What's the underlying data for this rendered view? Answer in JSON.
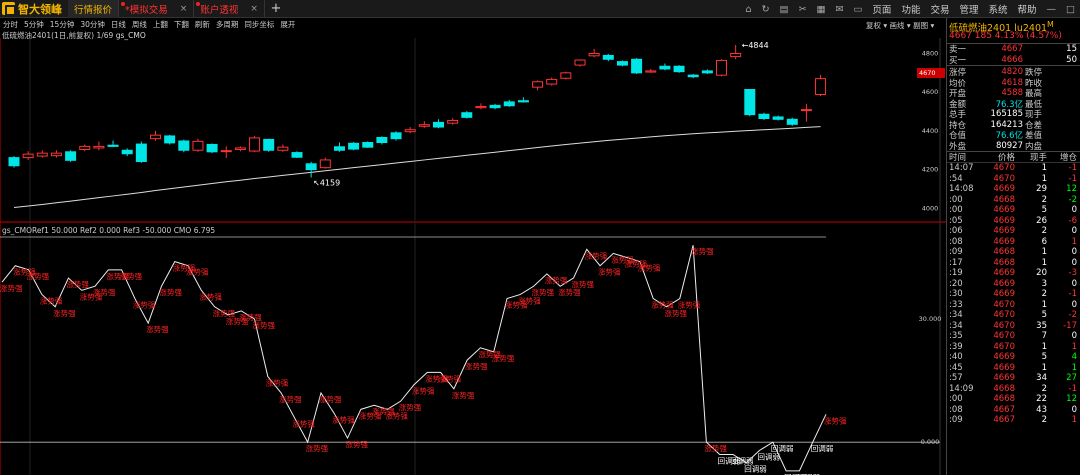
{
  "app": {
    "logo": "智大领峰",
    "tabs": [
      {
        "label": "行情报价",
        "active": true
      },
      {
        "label": "*模拟交易",
        "active": false
      },
      {
        "label": "账户透视",
        "active": false
      }
    ],
    "tab_close": "×",
    "new_tab": "+",
    "menu": [
      "页面",
      "功能",
      "交易",
      "管理",
      "系统",
      "帮助"
    ]
  },
  "toolbar": {
    "items": [
      "分时",
      "5分钟",
      "15分钟",
      "30分钟",
      "日线",
      "周线",
      "上翻",
      "下翻",
      "刷新",
      "多周期",
      "同步坐标",
      "展开"
    ],
    "right": [
      "复权",
      "画线",
      "副图"
    ]
  },
  "chart_title": {
    "text": "低硫燃油2401(1日,前复权) 1/69",
    "indicator": "gs_CMO"
  },
  "indicator_title": "gs_CMORef1 50.000 Ref2 0.000 Ref3 -50.000 CMO 6.795",
  "main_chart": {
    "y_ticks": [
      "4800",
      "4600",
      "4400",
      "4200",
      "4000"
    ],
    "high_label": "4844",
    "low_label": "4159",
    "current_price_tag": "4670"
  },
  "indicator_chart": {
    "y_ticks": [
      "30.000",
      "0.000"
    ],
    "strong_label": "涨势强",
    "weak_label": "回调弱"
  },
  "chart_data": [
    {
      "type": "candlestick",
      "title": "低硫燃油2401(1日,前复权)",
      "ylim": [
        3950,
        4880
      ],
      "candles": [
        {
          "o": 4262,
          "c": 4220,
          "h": 4270,
          "l": 4210
        },
        {
          "o": 4262,
          "c": 4280,
          "h": 4295,
          "l": 4250
        },
        {
          "o": 4270,
          "c": 4285,
          "h": 4300,
          "l": 4262
        },
        {
          "o": 4272,
          "c": 4285,
          "h": 4300,
          "l": 4262
        },
        {
          "o": 4292,
          "c": 4248,
          "h": 4300,
          "l": 4240
        },
        {
          "o": 4304,
          "c": 4320,
          "h": 4330,
          "l": 4295
        },
        {
          "o": 4312,
          "c": 4320,
          "h": 4345,
          "l": 4300
        },
        {
          "o": 4326,
          "c": 4320,
          "h": 4350,
          "l": 4316
        },
        {
          "o": 4300,
          "c": 4282,
          "h": 4310,
          "l": 4270
        },
        {
          "o": 4332,
          "c": 4242,
          "h": 4345,
          "l": 4235
        },
        {
          "o": 4360,
          "c": 4378,
          "h": 4400,
          "l": 4350
        },
        {
          "o": 4374,
          "c": 4338,
          "h": 4380,
          "l": 4330
        },
        {
          "o": 4348,
          "c": 4300,
          "h": 4355,
          "l": 4290
        },
        {
          "o": 4300,
          "c": 4346,
          "h": 4360,
          "l": 4292
        },
        {
          "o": 4330,
          "c": 4292,
          "h": 4335,
          "l": 4285
        },
        {
          "o": 4294,
          "c": 4298,
          "h": 4320,
          "l": 4260
        },
        {
          "o": 4304,
          "c": 4312,
          "h": 4320,
          "l": 4295
        },
        {
          "o": 4296,
          "c": 4364,
          "h": 4375,
          "l": 4290
        },
        {
          "o": 4356,
          "c": 4300,
          "h": 4360,
          "l": 4292
        },
        {
          "o": 4300,
          "c": 4316,
          "h": 4330,
          "l": 4292
        },
        {
          "o": 4288,
          "c": 4264,
          "h": 4295,
          "l": 4260
        },
        {
          "o": 4230,
          "c": 4200,
          "h": 4240,
          "l": 4159
        },
        {
          "o": 4210,
          "c": 4250,
          "h": 4262,
          "l": 4205
        },
        {
          "o": 4318,
          "c": 4300,
          "h": 4340,
          "l": 4292
        },
        {
          "o": 4336,
          "c": 4306,
          "h": 4342,
          "l": 4300
        },
        {
          "o": 4340,
          "c": 4316,
          "h": 4346,
          "l": 4312
        },
        {
          "o": 4366,
          "c": 4340,
          "h": 4372,
          "l": 4330
        },
        {
          "o": 4390,
          "c": 4360,
          "h": 4398,
          "l": 4350
        },
        {
          "o": 4396,
          "c": 4406,
          "h": 4420,
          "l": 4388
        },
        {
          "o": 4424,
          "c": 4432,
          "h": 4450,
          "l": 4416
        },
        {
          "o": 4444,
          "c": 4420,
          "h": 4460,
          "l": 4414
        },
        {
          "o": 4440,
          "c": 4454,
          "h": 4466,
          "l": 4432
        },
        {
          "o": 4494,
          "c": 4470,
          "h": 4502,
          "l": 4464
        },
        {
          "o": 4520,
          "c": 4526,
          "h": 4542,
          "l": 4512
        },
        {
          "o": 4532,
          "c": 4520,
          "h": 4540,
          "l": 4512
        },
        {
          "o": 4550,
          "c": 4530,
          "h": 4560,
          "l": 4524
        },
        {
          "o": 4556,
          "c": 4550,
          "h": 4574,
          "l": 4546
        },
        {
          "o": 4626,
          "c": 4654,
          "h": 4660,
          "l": 4610
        },
        {
          "o": 4642,
          "c": 4666,
          "h": 4676,
          "l": 4634
        },
        {
          "o": 4672,
          "c": 4700,
          "h": 4706,
          "l": 4666
        },
        {
          "o": 4740,
          "c": 4766,
          "h": 4770,
          "l": 4732
        },
        {
          "o": 4788,
          "c": 4800,
          "h": 4824,
          "l": 4780
        },
        {
          "o": 4790,
          "c": 4770,
          "h": 4798,
          "l": 4760
        },
        {
          "o": 4758,
          "c": 4740,
          "h": 4764,
          "l": 4734
        },
        {
          "o": 4770,
          "c": 4700,
          "h": 4776,
          "l": 4694
        },
        {
          "o": 4704,
          "c": 4710,
          "h": 4720,
          "l": 4700
        },
        {
          "o": 4734,
          "c": 4720,
          "h": 4748,
          "l": 4714
        },
        {
          "o": 4734,
          "c": 4706,
          "h": 4740,
          "l": 4700
        },
        {
          "o": 4688,
          "c": 4680,
          "h": 4694,
          "l": 4672
        },
        {
          "o": 4710,
          "c": 4700,
          "h": 4718,
          "l": 4694
        },
        {
          "o": 4688,
          "c": 4764,
          "h": 4770,
          "l": 4682
        },
        {
          "o": 4784,
          "c": 4800,
          "h": 4844,
          "l": 4770
        },
        {
          "o": 4614,
          "c": 4484,
          "h": 4616,
          "l": 4476
        },
        {
          "o": 4486,
          "c": 4464,
          "h": 4494,
          "l": 4456
        },
        {
          "o": 4472,
          "c": 4460,
          "h": 4480,
          "l": 4454
        },
        {
          "o": 4460,
          "c": 4434,
          "h": 4468,
          "l": 4426
        },
        {
          "o": 4506,
          "c": 4510,
          "h": 4540,
          "l": 4448
        },
        {
          "o": 4588,
          "c": 4670,
          "h": 4690,
          "l": 4580
        }
      ],
      "ma": [
        4004,
        4012,
        4020,
        4029,
        4037,
        4046,
        4055,
        4064,
        4073,
        4082,
        4092,
        4101,
        4110,
        4119,
        4128,
        4137,
        4145,
        4154,
        4162,
        4170,
        4178,
        4186,
        4194,
        4202,
        4210,
        4218,
        4226,
        4234,
        4242,
        4250,
        4258,
        4266,
        4274,
        4282,
        4290,
        4298,
        4306,
        4314,
        4322,
        4330,
        4337,
        4344,
        4351,
        4357,
        4363,
        4369,
        4375,
        4380,
        4385,
        4390,
        4394,
        4398,
        4402,
        4406,
        4410,
        4414,
        4418,
        4422
      ]
    },
    {
      "type": "line",
      "title": "gs_CMO",
      "ylim": [
        -8,
        50
      ],
      "ref_lines": [
        50,
        0
      ],
      "values": [
        39,
        43,
        42,
        36,
        33,
        40,
        37,
        38,
        42,
        42,
        35,
        29,
        38,
        44,
        43,
        37,
        33,
        31,
        32,
        30,
        16,
        12,
        6,
        0,
        12,
        7,
        1,
        8,
        9,
        8,
        10,
        14,
        17,
        17,
        13,
        20,
        23,
        22,
        35,
        36,
        38,
        41,
        38,
        40,
        47,
        43,
        46,
        45,
        44,
        35,
        33,
        35,
        48,
        0,
        -3,
        -3,
        -5,
        -2,
        0,
        -7,
        -7,
        0,
        6.795
      ],
      "labels": [
        "涨势强",
        "涨势强",
        "涨势强",
        "涨势强",
        "涨势强",
        "涨势强",
        "涨势强",
        "涨势强",
        "涨势强",
        "涨势强",
        "涨势强",
        "涨势强",
        "涨势强",
        "涨势强",
        "涨势强",
        "涨势强",
        "涨势强",
        "涨势强",
        "涨势强",
        "涨势强",
        "涨势强",
        "涨势强",
        "涨势强",
        "涨势强",
        "涨势强",
        "涨势强",
        "涨势强",
        "涨势强",
        "涨势强",
        "涨势强",
        "涨势强",
        "涨势强",
        "涨势强",
        "涨势强",
        "涨势强",
        "涨势强",
        "涨势强",
        "涨势强",
        "涨势强",
        "涨势强",
        "涨势强",
        "涨势强",
        "涨势强",
        "涨势强",
        "涨势强",
        "涨势强",
        "涨势强",
        "涨势强",
        "涨势强",
        "涨势强",
        "涨势强",
        "涨势强",
        "涨势强",
        "涨势强",
        "回调弱",
        "回调弱",
        "回调弱",
        "回调弱",
        "回调弱",
        "回调弱",
        "回调弱",
        "回调弱",
        "涨势强"
      ]
    }
  ],
  "quote": {
    "title": "低硫燃油2401  lu2401",
    "title_mark": "M",
    "price_line": "4667  185  4.13%  (4.57%)",
    "sell_label": "卖一",
    "sell_price": "4667",
    "sell_vol": "15",
    "buy_label": "买一",
    "buy_price": "4666",
    "buy_vol": "50",
    "stats": [
      {
        "k": "涨停",
        "v": "4820",
        "c": "red",
        "k2": "跌停"
      },
      {
        "k": "均价",
        "v": "4618",
        "c": "red",
        "k2": "昨收"
      },
      {
        "k": "开盘",
        "v": "4588",
        "c": "red",
        "k2": "最高"
      },
      {
        "k": "金额",
        "v": "76.3亿",
        "c": "cyan",
        "k2": "最低"
      },
      {
        "k": "总手",
        "v": "165185",
        "c": "white",
        "k2": "现手"
      },
      {
        "k": "持仓",
        "v": "164213",
        "c": "white",
        "k2": "仓差"
      },
      {
        "k": "仓值",
        "v": "76.6亿",
        "c": "cyan",
        "k2": "差值"
      },
      {
        "k": "外盘",
        "v": "80927",
        "c": "white",
        "k2": "内盘"
      }
    ],
    "ticks_head": [
      "时间",
      "价格",
      "现手",
      "增仓"
    ],
    "ticks": [
      {
        "t": "14:07",
        "p": "4670",
        "v": "1",
        "d": "-1",
        "dc": "red"
      },
      {
        "t": ":54",
        "p": "4670",
        "v": "1",
        "d": "-1",
        "dc": "red"
      },
      {
        "t": "14:08",
        "p": "4669",
        "v": "29",
        "d": "12",
        "dc": "green"
      },
      {
        "t": ":00",
        "p": "4668",
        "v": "2",
        "d": "-2",
        "dc": "green"
      },
      {
        "t": ":00",
        "p": "4669",
        "v": "5",
        "d": "0",
        "dc": "white"
      },
      {
        "t": ":05",
        "p": "4669",
        "v": "26",
        "d": "-6",
        "dc": "red"
      },
      {
        "t": ":06",
        "p": "4669",
        "v": "2",
        "d": "0",
        "dc": "white"
      },
      {
        "t": ":08",
        "p": "4669",
        "v": "6",
        "d": "1",
        "dc": "red"
      },
      {
        "t": ":09",
        "p": "4668",
        "v": "1",
        "d": "0",
        "dc": "white"
      },
      {
        "t": ":17",
        "p": "4668",
        "v": "1",
        "d": "0",
        "dc": "white"
      },
      {
        "t": ":19",
        "p": "4669",
        "v": "20",
        "d": "-3",
        "dc": "red"
      },
      {
        "t": ":20",
        "p": "4669",
        "v": "3",
        "d": "0",
        "dc": "white"
      },
      {
        "t": ":30",
        "p": "4669",
        "v": "2",
        "d": "-1",
        "dc": "red"
      },
      {
        "t": ":33",
        "p": "4670",
        "v": "1",
        "d": "0",
        "dc": "white"
      },
      {
        "t": ":34",
        "p": "4670",
        "v": "5",
        "d": "-2",
        "dc": "red"
      },
      {
        "t": ":34",
        "p": "4670",
        "v": "35",
        "d": "-17",
        "dc": "red"
      },
      {
        "t": ":35",
        "p": "4670",
        "v": "7",
        "d": "0",
        "dc": "white"
      },
      {
        "t": ":39",
        "p": "4670",
        "v": "1",
        "d": "1",
        "dc": "red"
      },
      {
        "t": ":40",
        "p": "4669",
        "v": "5",
        "d": "4",
        "dc": "green"
      },
      {
        "t": ":45",
        "p": "4669",
        "v": "1",
        "d": "1",
        "dc": "green"
      },
      {
        "t": ":57",
        "p": "4669",
        "v": "34",
        "d": "27",
        "dc": "green"
      },
      {
        "t": "14:09",
        "p": "4668",
        "v": "2",
        "d": "-1",
        "dc": "red"
      },
      {
        "t": ":00",
        "p": "4668",
        "v": "22",
        "d": "12",
        "dc": "green"
      },
      {
        "t": ":08",
        "p": "4667",
        "v": "43",
        "d": "0",
        "dc": "white"
      },
      {
        "t": ":09",
        "p": "4667",
        "v": "2",
        "d": "1",
        "dc": "red"
      }
    ]
  }
}
